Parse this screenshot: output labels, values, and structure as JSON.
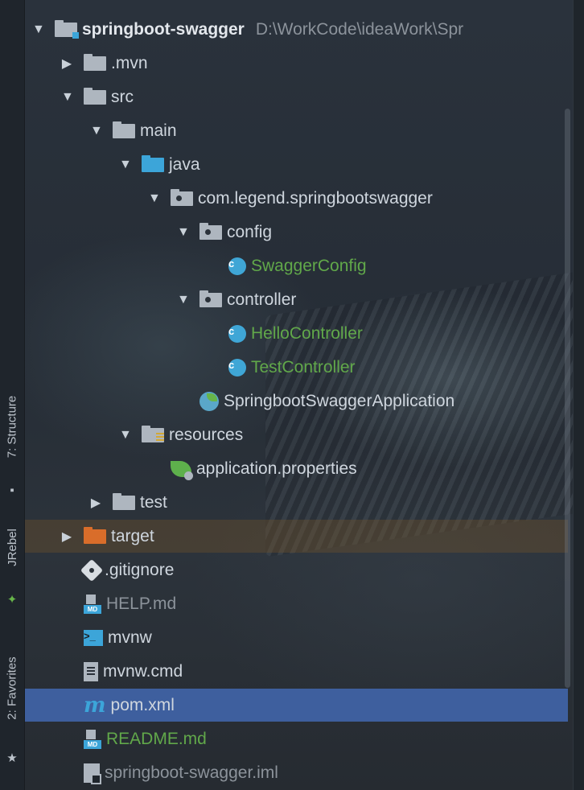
{
  "tool_windows": {
    "structure": "7: Structure",
    "jrebel": "JRebel",
    "favorites": "2: Favorites"
  },
  "tree": [
    {
      "label": "springboot-swagger",
      "suffix": "D:\\WorkCode\\ideaWork\\Spr",
      "icon": "module-folder-icon",
      "arrow": "▼",
      "level": 0
    },
    {
      "label": ".mvn",
      "icon": "folder-icon",
      "arrow": "▶",
      "level": 1
    },
    {
      "label": "src",
      "icon": "folder-icon",
      "arrow": "▼",
      "level": 1
    },
    {
      "label": "main",
      "icon": "folder-icon",
      "arrow": "▼",
      "level": 2
    },
    {
      "label": "java",
      "icon": "source-folder-icon",
      "arrow": "▼",
      "level": 3
    },
    {
      "label": "com.legend.springbootswagger",
      "icon": "package-icon",
      "arrow": "▼",
      "level": 4
    },
    {
      "label": "config",
      "icon": "package-icon",
      "arrow": "▼",
      "level": 5
    },
    {
      "label": "SwaggerConfig",
      "icon": "class-icon",
      "level": 6,
      "color": "#61a84a"
    },
    {
      "label": "controller",
      "icon": "package-icon",
      "arrow": "▼",
      "level": 5
    },
    {
      "label": "HelloController",
      "icon": "class-icon",
      "level": 6,
      "color": "#61a84a"
    },
    {
      "label": "TestController",
      "icon": "class-icon",
      "level": 6,
      "color": "#61a84a"
    },
    {
      "label": "SpringbootSwaggerApplication",
      "icon": "spring-boot-class-icon",
      "level": 5
    },
    {
      "label": "resources",
      "icon": "resources-folder-icon",
      "arrow": "▼",
      "level": 3
    },
    {
      "label": "application.properties",
      "icon": "spring-properties-icon",
      "level": 4
    },
    {
      "label": "test",
      "icon": "folder-icon",
      "arrow": "▶",
      "level": 2
    },
    {
      "label": "target",
      "icon": "excluded-folder-icon",
      "arrow": "▶",
      "level": 1
    },
    {
      "label": ".gitignore",
      "icon": "git-icon",
      "level": 1
    },
    {
      "label": "HELP.md",
      "icon": "markdown-icon",
      "level": 1,
      "color": "#8c939b"
    },
    {
      "label": "mvnw",
      "icon": "terminal-icon",
      "level": 1
    },
    {
      "label": "mvnw.cmd",
      "icon": "text-file-icon",
      "level": 1
    },
    {
      "label": "pom.xml",
      "icon": "maven-icon",
      "level": 1
    },
    {
      "label": "README.md",
      "icon": "markdown-icon",
      "level": 1,
      "color": "#61a84a"
    },
    {
      "label": "springboot-swagger.iml",
      "icon": "iml-file-icon",
      "level": 1,
      "color": "#8c939b"
    }
  ],
  "colors": {
    "selection": "#3e5f9e",
    "vcs_added": "#61a84a",
    "ignored": "#8c939b",
    "excluded_folder": "#d96d2a"
  }
}
